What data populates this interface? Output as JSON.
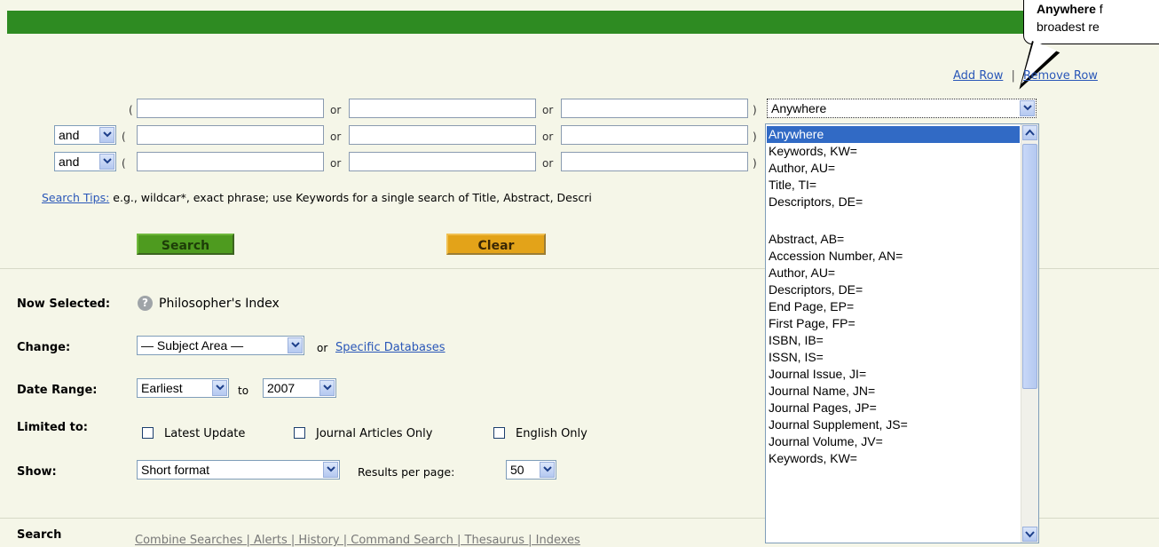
{
  "callout": {
    "bold": "Anywhere",
    "line1_rest": " f",
    "line2": "broadest re"
  },
  "row_links": {
    "add": "Add Row",
    "sep": "|",
    "remove": "Remove Row"
  },
  "query": {
    "paren_open": "(",
    "paren_close": ")",
    "or": "or",
    "connector": "and",
    "field_selected": "Anywhere"
  },
  "tips": {
    "link": "Search Tips:",
    "text": " e.g., wildcar*, exact phrase; use Keywords for a single search of Title, Abstract, Descri"
  },
  "buttons": {
    "search": "Search",
    "clear": "Clear"
  },
  "now_selected": {
    "label": "Now Selected:",
    "value": "Philosopher's Index"
  },
  "change": {
    "label": "Change:",
    "subject": "— Subject Area —",
    "or": "or",
    "link": "Specific Databases"
  },
  "date_range": {
    "label": "Date Range:",
    "from": "Earliest",
    "to_label": "to",
    "to": "2007"
  },
  "limited": {
    "label": "Limited to:",
    "opt1": "Latest Update",
    "opt2": "Journal Articles Only",
    "opt3": "English Only"
  },
  "show": {
    "label": "Show:",
    "format": "Short format",
    "rpp_label": "Results per page:",
    "rpp": "50"
  },
  "search_section": {
    "label": "Search",
    "links": "Combine Searches | Alerts | History | Command Search | Thesaurus | Indexes"
  },
  "field_options": [
    "Anywhere",
    "Keywords, KW=",
    "Author, AU=",
    "Title, TI=",
    "Descriptors, DE=",
    "Abstract, AB=",
    "Accession Number, AN=",
    "Author, AU=",
    "Descriptors, DE=",
    "End Page, EP=",
    "First Page, FP=",
    "ISBN, IB=",
    "ISSN, IS=",
    "Journal Issue, JI=",
    "Journal Name, JN=",
    "Journal Pages, JP=",
    "Journal Supplement, JS=",
    "Journal Volume, JV=",
    "Keywords, KW="
  ],
  "colors": {
    "header": "#2e8b22",
    "search_btn": "#4e9b1f",
    "clear_btn": "#e3a319",
    "highlight": "#316ac5"
  }
}
